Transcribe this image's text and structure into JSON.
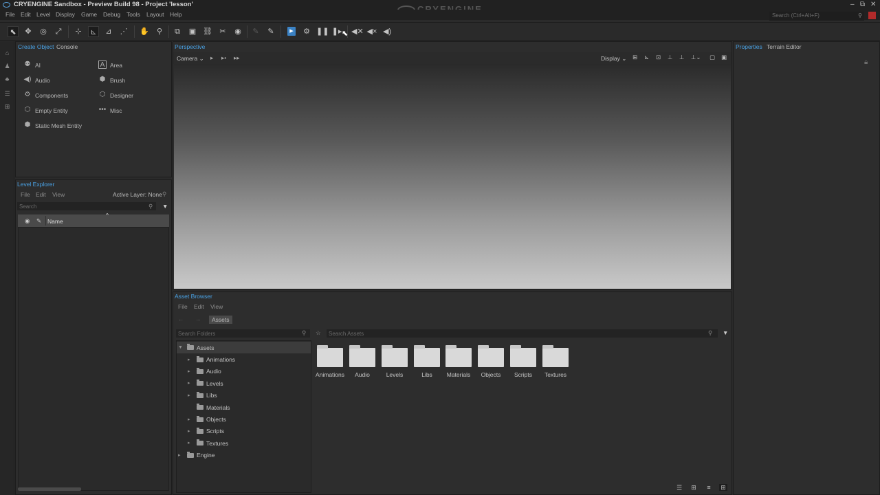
{
  "window": {
    "title": "CRYENGINE Sandbox - Preview Build 98 - Project 'lesson'",
    "logo_text": "CRYENGINE",
    "controls": [
      "–",
      "⧉",
      "✕"
    ]
  },
  "menu": {
    "items": [
      "File",
      "Edit",
      "Level",
      "Display",
      "Game",
      "Debug",
      "Tools",
      "Layout",
      "Help"
    ],
    "search_placeholder": "Search (Ctrl+Alt+F)"
  },
  "left_panel": {
    "tabs": [
      "Create Object",
      "Console"
    ],
    "objects": [
      {
        "label": "AI",
        "icon": "ai-icon"
      },
      {
        "label": "Area",
        "icon": "area-icon"
      },
      {
        "label": "Audio",
        "icon": "audio-icon"
      },
      {
        "label": "Brush",
        "icon": "brush-icon"
      },
      {
        "label": "Components",
        "icon": "components-icon"
      },
      {
        "label": "Designer",
        "icon": "designer-icon"
      },
      {
        "label": "Empty Entity",
        "icon": "empty-entity-icon"
      },
      {
        "label": "Misc",
        "icon": "misc-icon"
      },
      {
        "label": "Static Mesh Entity",
        "icon": "static-mesh-icon"
      }
    ]
  },
  "level_explorer": {
    "title": "Level Explorer",
    "menu": [
      "File",
      "Edit",
      "View"
    ],
    "active_layer": "Active Layer: None",
    "search_placeholder": "Search",
    "column_name": "Name"
  },
  "viewport": {
    "title": "Perspective",
    "camera_label": "Camera",
    "display_label": "Display"
  },
  "asset_browser": {
    "title": "Asset Browser",
    "menu": [
      "File",
      "Edit",
      "View"
    ],
    "breadcrumb": "Assets",
    "folder_search_placeholder": "Search Folders",
    "asset_search_placeholder": "Search Assets",
    "tree": {
      "root": "Assets",
      "children": [
        "Animations",
        "Audio",
        "Levels",
        "Libs",
        "Materials",
        "Objects",
        "Scripts",
        "Textures"
      ],
      "engine": "Engine"
    },
    "folders": [
      "Animations",
      "Audio",
      "Levels",
      "Libs",
      "Materials",
      "Objects",
      "Scripts",
      "Textures"
    ]
  },
  "properties": {
    "tabs": [
      "Properties",
      "Terrain Editor"
    ]
  },
  "colors": {
    "accent": "#4aa3e6",
    "toolbar_active": "#3b82c4",
    "close_button": "#b22a2a"
  }
}
